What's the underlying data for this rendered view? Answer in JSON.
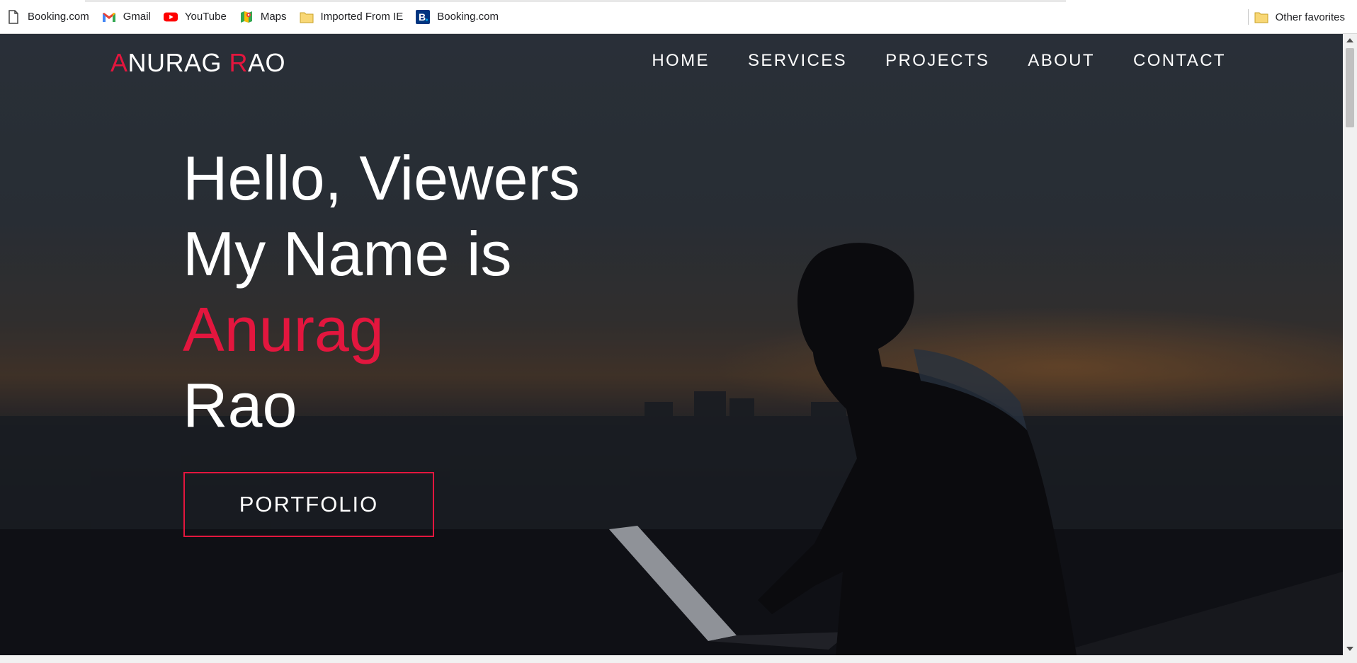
{
  "bookmarks": {
    "items": [
      {
        "label": "Booking.com",
        "icon": "page-icon"
      },
      {
        "label": "Gmail",
        "icon": "gmail-icon"
      },
      {
        "label": "YouTube",
        "icon": "youtube-icon"
      },
      {
        "label": "Maps",
        "icon": "maps-icon"
      },
      {
        "label": "Imported From IE",
        "icon": "folder-icon"
      },
      {
        "label": "Booking.com",
        "icon": "booking-icon"
      }
    ],
    "other": {
      "label": "Other favorites",
      "icon": "folder-icon"
    }
  },
  "site": {
    "logo": {
      "first_initial": "A",
      "first_rest": "NURAG ",
      "last_initial": "R",
      "last_rest": "AO"
    },
    "nav": [
      "HOME",
      "SERVICES",
      "PROJECTS",
      "ABOUT",
      "CONTACT"
    ]
  },
  "hero": {
    "line1": "Hello, Viewers",
    "line2": "My Name is",
    "first_name": "Anurag",
    "last_name": "Rao",
    "cta": "PORTFOLIO"
  },
  "colors": {
    "accent": "#e3163e",
    "text": "#ffffff",
    "bookmark_bar": "#ffffff"
  }
}
